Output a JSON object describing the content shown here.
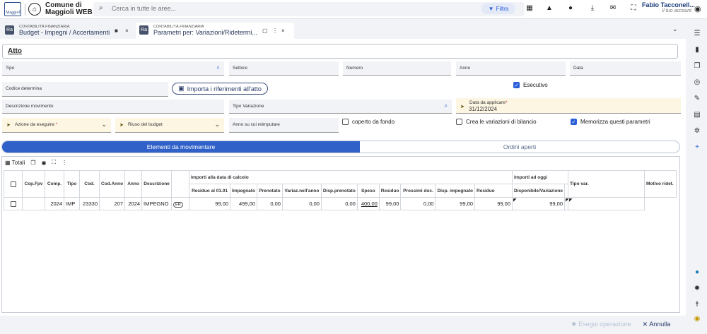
{
  "app": {
    "logo_text": "Maggiolì",
    "name_line1": "Comune di",
    "name_line2": "Maggioli WEB"
  },
  "search": {
    "placeholder": "Cerca in tutte le aree...",
    "filter_label": "Filtra"
  },
  "user": {
    "name": "Fabio Tacconell...",
    "role": "Il tuo account"
  },
  "tabs": [
    {
      "module": "CONTABILITÀ FINANZIARIA",
      "title": "Budget - Impegni / Accertamenti",
      "badge": "Ra"
    },
    {
      "module": "CONTABILITÀ FINANZIARIA",
      "title": "Parametri per: Variazioni/Ridetermi...",
      "badge": "Ra"
    }
  ],
  "form": {
    "atto_title": "Atto",
    "tipo": "Tipo",
    "settore": "Settore",
    "numero": "Numero",
    "anno": "Anno",
    "data": "Data",
    "codice_determina": "Codice determina",
    "importa_label": "Importa i riferimenti all'atto",
    "esecutivo": "Esecutivo",
    "descrizione_movimento": "Descrizione movimento",
    "tipo_variazione": "Tipo Variazione",
    "data_applicare_label": "Data da applicare",
    "data_applicare_value": "31/12/2024",
    "azione_label": "Azione da eseguire:",
    "riuso_label": "Riuso del budget",
    "anno_reimputare": "Anno su cui reimputare",
    "coperto_fondo": "coperto da fondo",
    "crea_variazioni": "Crea le variazioni di bilancio",
    "memorizza": "Memorizza questi parametri",
    "required_mark": "*"
  },
  "segments": {
    "active": "Elementi da movimentare",
    "inactive": "Ordini aperti"
  },
  "grid": {
    "toolbar_totali": "Totali",
    "headers": {
      "cop_fpv": "Cop.Fpv",
      "comp": "Comp.",
      "tipo": "Tipo",
      "cod": "Cod.",
      "cod_anno": "Cod.Anno",
      "anno": "Anno",
      "descrizione": "Descrizione",
      "group_calcolo": "Importi alla data di calcolo",
      "group_oggi": "Importi ad oggi",
      "residuo_0101": "Residuo al 01.01",
      "impegnato": "Impegnato",
      "prenotato": "Prenotato",
      "variaz_anno": "Variaz.nell'anno",
      "disp_prenotato": "Disp.prenotato",
      "speso": "Speso",
      "residuo": "Residuo",
      "prossimi_doc": "Prossimi doc.",
      "disp_impegnato": "Disp. impegnato",
      "residuo_oggi": "Residuo",
      "disponibile_variazione": "Disponibile/Variazione",
      "tipo_var": "Tipo var.",
      "motivo_ridet": "Motivo ridet."
    },
    "rows": [
      {
        "comp": "2024",
        "tipo": "IMP",
        "cod": "23330",
        "cod_anno": "207",
        "anno": "2024",
        "descrizione": "IMPEGNO",
        "badge": "ER",
        "residuo_0101": "99,00",
        "impegnato": "499,00",
        "prenotato": "0,00",
        "variaz_anno": "0,00",
        "disp_prenotato": "0,00",
        "speso": "400,00",
        "residuo": "99,00",
        "prossimi_doc": "0,00",
        "disp_impegnato": "99,00",
        "residuo_oggi": "99,00",
        "disponibile_variazione": "99,00"
      }
    ]
  },
  "footer": {
    "esegui": "Esegui operazione",
    "annulla": "Annulla"
  },
  "colors": {
    "accent": "#2f61c9",
    "warning_field_bg": "#fdf6e3",
    "required": "#d32f2f"
  }
}
